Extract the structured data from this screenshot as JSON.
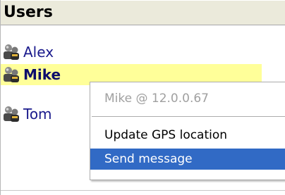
{
  "header": {
    "title": "Users"
  },
  "users": [
    {
      "name": "Alex",
      "icon": "users-icon",
      "selected": false
    },
    {
      "name": "Mike",
      "icon": "users-icon",
      "selected": true
    },
    {
      "name": "Tom",
      "icon": "users-icon",
      "selected": false
    }
  ],
  "context_menu": {
    "header_item": "Mike @ 12.0.0.67",
    "items": [
      {
        "label": "Update GPS location"
      },
      {
        "label": "Send message"
      }
    ]
  },
  "colors": {
    "highlight": "#ffff99",
    "selection": "#316ac5",
    "header_bg": "#ebeadb",
    "user_text": "#1a1a8c"
  }
}
